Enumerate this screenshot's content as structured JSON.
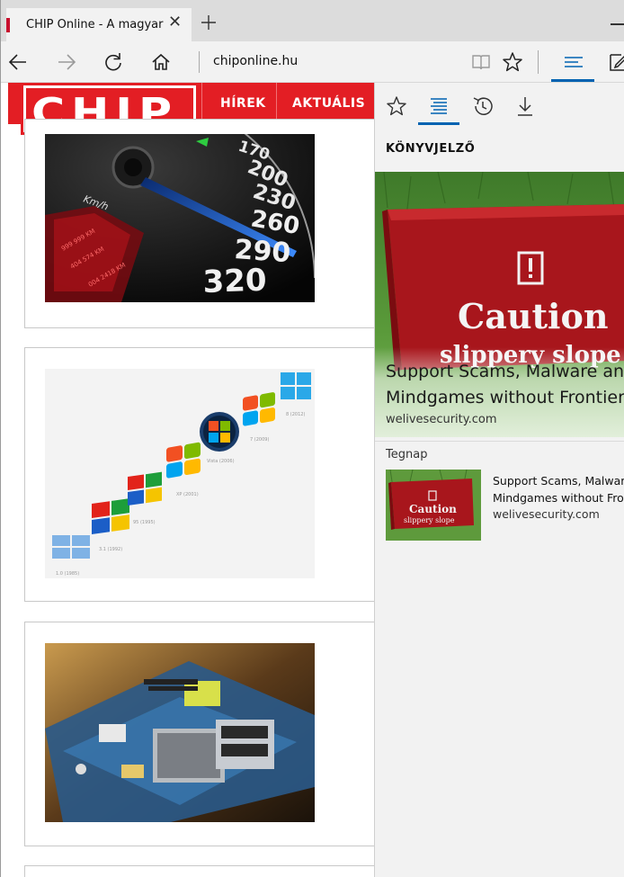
{
  "browser": {
    "tab": {
      "title": "CHIP Online - A magyar",
      "close_glyph": "✕"
    },
    "address": "chiponline.hu",
    "accent_color": "#0063b1"
  },
  "site": {
    "logo_text": "CHIP",
    "nav": [
      "HÍREK",
      "AKTUÁLIS"
    ],
    "brand_color": "#e31e24"
  },
  "hub": {
    "tabs": [
      "favorites-icon",
      "reading-list-icon",
      "history-icon",
      "downloads-icon"
    ],
    "heading": "KÖNYVJELZŐ",
    "featured": {
      "sign_line1": "Caution",
      "sign_line2": "slippery slope",
      "title_line1": "Support Scams, Malware and",
      "title_line2": "Mindgames without Frontiers",
      "source": "welivesecurity.com"
    },
    "section_label": "Tegnap",
    "items": [
      {
        "title_line1": "Support Scams, Malware and",
        "title_line2": "Mindgames without Frontiers",
        "source": "welivesecurity.com",
        "sign_line1": "Caution",
        "sign_line2": "slippery slope"
      }
    ]
  },
  "thumbnails": {
    "speedometer": {
      "unit": "Km/h",
      "numbers": [
        "170",
        "200",
        "230",
        "260",
        "290",
        "320"
      ]
    },
    "windows": {
      "labels": [
        "1.0 (1985)",
        "3.1 (1992)",
        "95 (1995)",
        "XP (2001)",
        "Vista (2006)",
        "7 (2009)",
        "8 (2012)"
      ]
    }
  }
}
